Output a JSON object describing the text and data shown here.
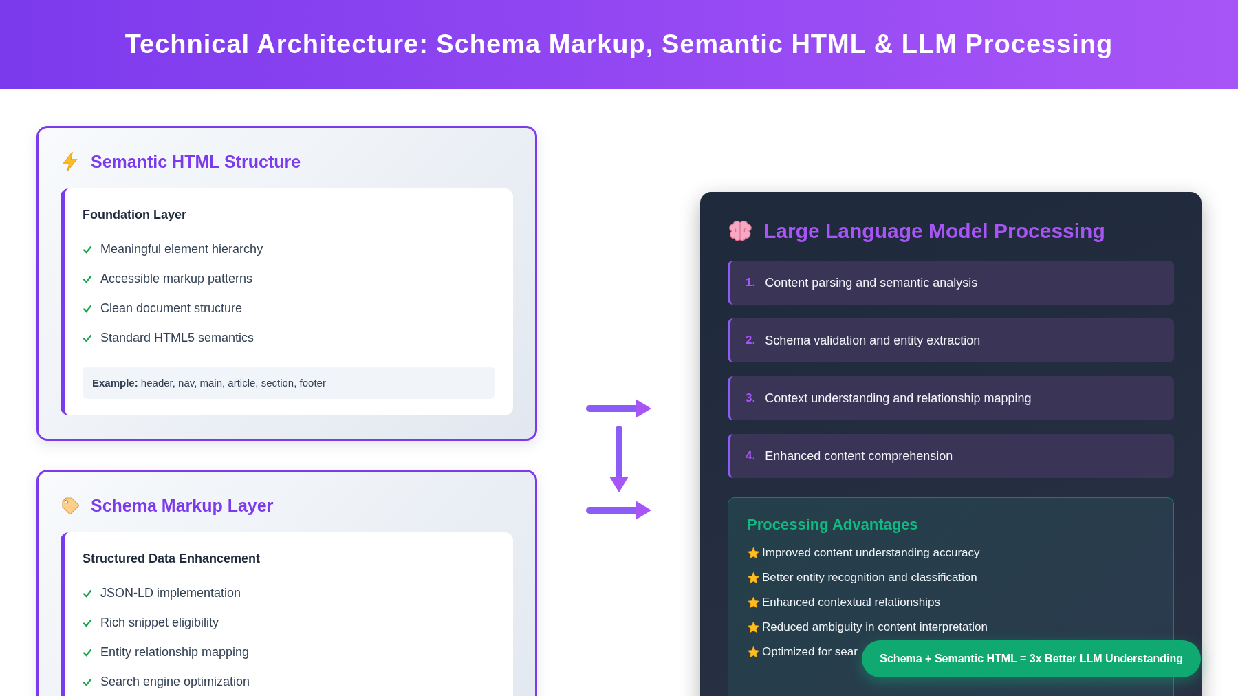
{
  "header": {
    "title": "Technical Architecture: Schema Markup, Semantic HTML & LLM Processing"
  },
  "layers": [
    {
      "kind": "bolt",
      "title": "Semantic HTML Structure",
      "subtitle": "Foundation Layer",
      "items": [
        "Meaningful element hierarchy",
        "Accessible markup patterns",
        "Clean document structure",
        "Standard HTML5 semantics"
      ],
      "example": "**Example:** header, nav, main, article, section, footer"
    },
    {
      "kind": "tag",
      "title": "Schema Markup Layer",
      "subtitle": "Structured Data Enhancement",
      "items": [
        "JSON-LD implementation",
        "Rich snippet eligibility",
        "Entity relationship mapping",
        "Search engine optimization"
      ]
    }
  ],
  "llm_panel": {
    "title": "Large Language Model Processing",
    "steps": [
      {
        "number": "1.",
        "text": "Content parsing and semantic analysis"
      },
      {
        "number": "2.",
        "text": "Schema validation and entity extraction"
      },
      {
        "number": "3.",
        "text": "Context understanding and relationship mapping"
      },
      {
        "number": "4.",
        "text": "Enhanced content comprehension"
      }
    ],
    "advantages": {
      "title": "Processing Advantages",
      "items": [
        "Improved content understanding accuracy",
        "Better entity recognition and classification",
        "Enhanced contextual relationships",
        "Reduced ambiguity in content interpretation",
        "Optimized for sear"
      ]
    }
  },
  "badge": "Schema + Semantic HTML = 3x Better LLM Understanding"
}
